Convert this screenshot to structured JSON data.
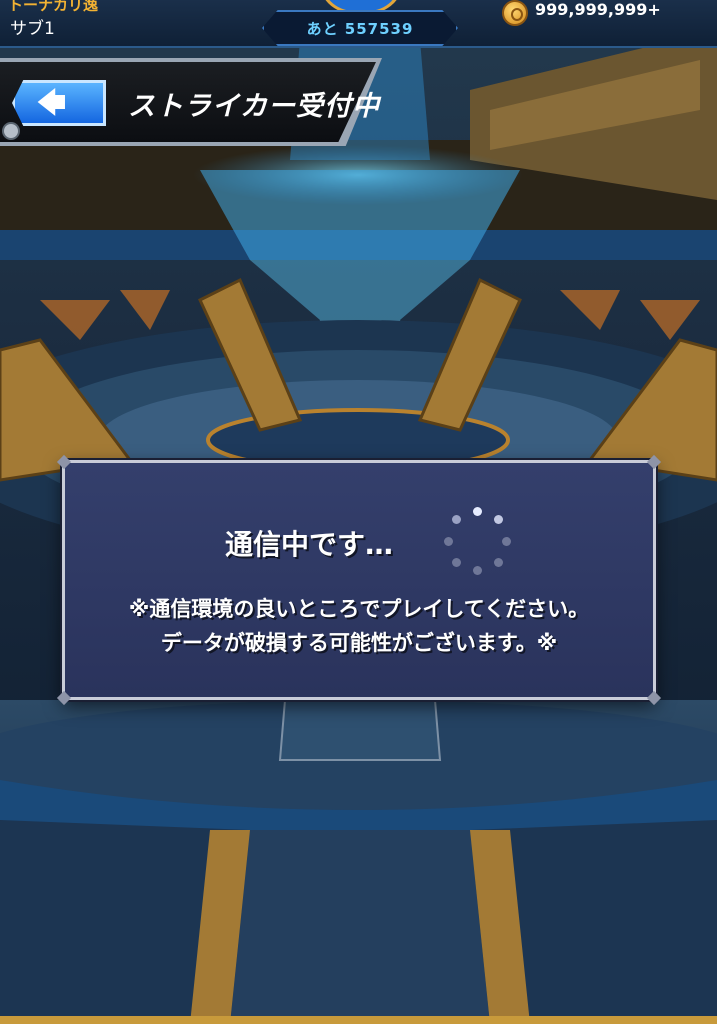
{
  "topbar": {
    "rank_label": "トーナカリ逸",
    "player_name": "サブ1",
    "stamina_label": "あと 557539",
    "coin_count": "999,999,999+",
    "coin_icon": "coin-icon"
  },
  "banner": {
    "back_icon": "back-arrow-icon",
    "back_glyph": "🡄",
    "title": "ストライカー受付中"
  },
  "dialog": {
    "status": "通信中です…",
    "note_line1": "※通信環境の良いところでプレイしてください。",
    "note_line2": "データが破損する可能性がございます。※",
    "spinner_icon": "loading-spinner-icon"
  },
  "colors": {
    "dialog_bg": "#343f6c",
    "back_button": "#1f78ea",
    "coin": "#f2b233",
    "stamina_text": "#6ed0ff"
  }
}
